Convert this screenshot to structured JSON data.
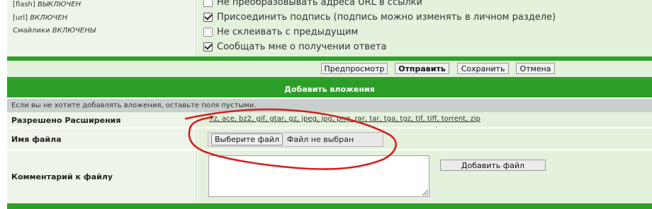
{
  "bbcode": {
    "flash_tag": "[flash]",
    "flash_state": "ВЫКЛЮЧЕН",
    "url_tag": "[url]",
    "url_state": "ВКЛЮЧЕН",
    "smilies_label": "Смайлики",
    "smilies_state": "ВКЛЮЧЕНЫ"
  },
  "options": [
    {
      "label": "Не преобразовывать адреса URL в ссылки",
      "checked": false
    },
    {
      "label": "Присоединить подпись (подпись можно изменять в личном разделе)",
      "checked": true
    },
    {
      "label": "Не склеивать с предыдущим",
      "checked": false
    },
    {
      "label": "Сообщать мне о получении ответа",
      "checked": true
    }
  ],
  "buttons": {
    "preview": "Предпросмотр",
    "submit": "Отправить",
    "save": "Сохранить",
    "cancel": "Отмена"
  },
  "attachments": {
    "header": "Добавить вложения",
    "hint": "Если вы не хотите добавлять вложения, оставьте поля пустыми.",
    "extensions_label": "Разрешено Расширения",
    "extensions": "7z, ace, bz2, gif, gtar, gz, jpeg, jpg, png, rar, tar, tga, tgz, tif, tiff, torrent, zip",
    "filename_label": "Имя файла",
    "choose_file": "Выберите файл",
    "no_file": "Файл не выбран",
    "comment_label": "Комментарий к файлу",
    "add_file": "Добавить файл"
  },
  "colors": {
    "green_bar": "#2fa12a",
    "label_bg": "#eef5e8",
    "value_bg": "#e4f1dc",
    "hint_bg": "#c9cfcc",
    "annotation_red": "#d42020"
  }
}
